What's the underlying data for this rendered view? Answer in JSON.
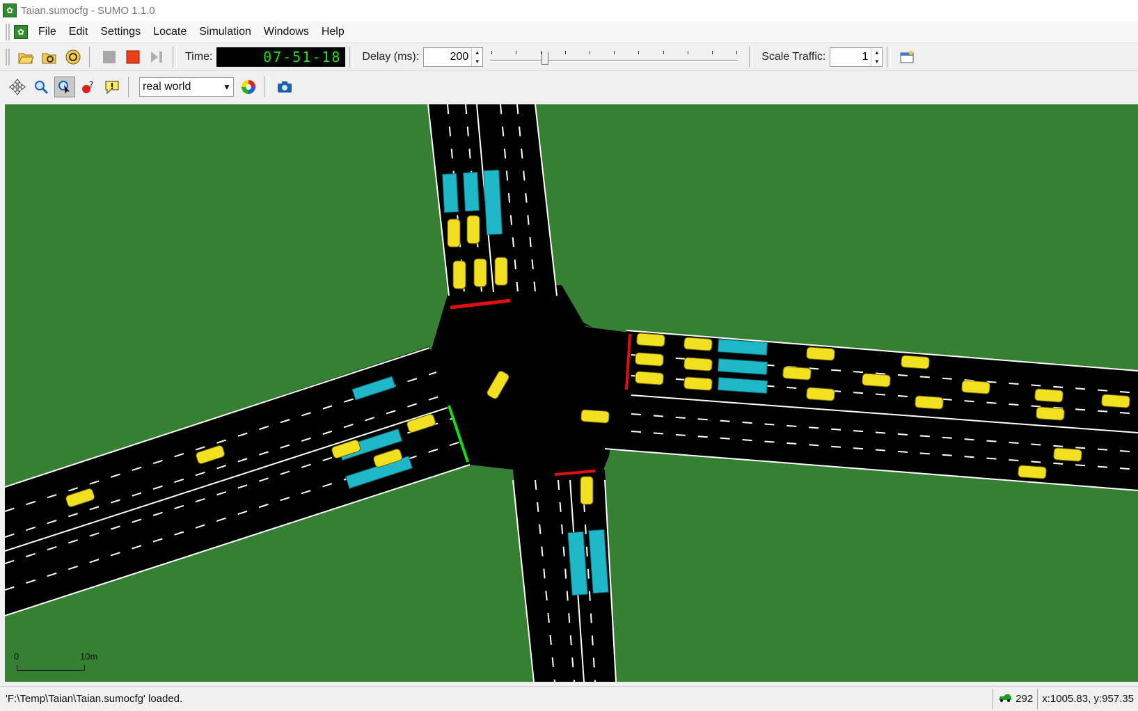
{
  "window": {
    "title": "Taian.sumocfg - SUMO 1.1.0"
  },
  "menu": [
    "File",
    "Edit",
    "Settings",
    "Locate",
    "Simulation",
    "Windows",
    "Help"
  ],
  "toolbar": {
    "time_label": "Time:",
    "time_value": "07-51-18",
    "delay_label": "Delay (ms):",
    "delay_value": "200",
    "delay_slider_fraction": 0.21,
    "scale_label": "Scale Traffic:",
    "scale_value": "1"
  },
  "view_toolbar": {
    "scheme_value": "real world"
  },
  "canvas": {
    "scale_start": "0",
    "scale_end": "10m",
    "colors": {
      "grass": "#358033",
      "road": "#000000",
      "vehicle": "#f0e020",
      "bus": "#1fb8c8",
      "red_signal": "#e01010",
      "green_signal": "#10e010"
    }
  },
  "status": {
    "message": "'F:\\Temp\\Taian\\Taian.sumocfg' loaded.",
    "vehicle_count": "292",
    "coords": "x:1005.83, y:957.35"
  },
  "icons": [
    "open-icon",
    "reload-icon",
    "recent-icon",
    "run-icon",
    "stop-icon",
    "step-icon",
    "new-view-icon",
    "recenter-icon",
    "zoom-icon",
    "select-icon",
    "locate-icon",
    "tooltip-icon",
    "color-wheel-icon",
    "screenshot-icon",
    "car-icon"
  ]
}
